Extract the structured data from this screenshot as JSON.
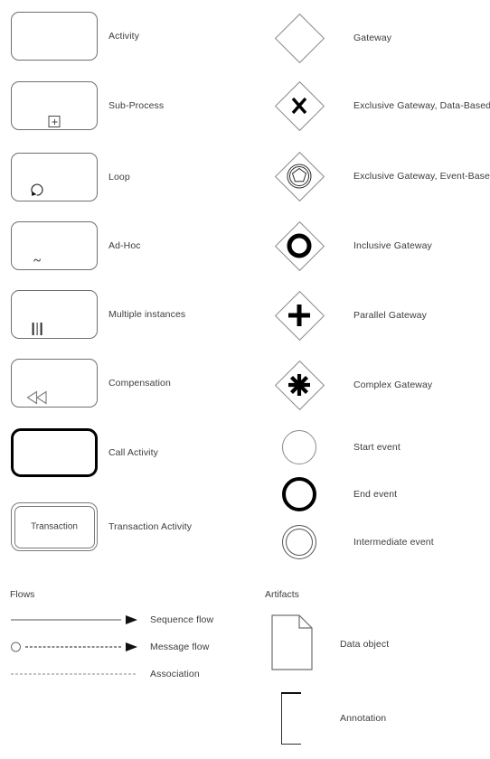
{
  "activities": [
    {
      "label": "Activity",
      "icon": "activity-rounded-rect"
    },
    {
      "label": "Sub-Process",
      "icon": "sub-process-plus-marker-icon"
    },
    {
      "label": "Loop",
      "icon": "loop-marker-icon"
    },
    {
      "label": "Ad-Hoc",
      "icon": "adhoc-tilde-marker-icon"
    },
    {
      "label": "Multiple instances",
      "icon": "multiple-instances-marker-icon"
    },
    {
      "label": "Compensation",
      "icon": "compensation-rewind-marker-icon"
    },
    {
      "label": "Call Activity",
      "icon": "call-activity-thick-rect-icon"
    },
    {
      "label": "Transaction Activity",
      "icon": "transaction-double-rect-icon",
      "inner_text": "Transaction"
    }
  ],
  "gateways": [
    {
      "label": "Gateway",
      "icon": "gateway-diamond-icon"
    },
    {
      "label": "Exclusive Gateway, Data-Based",
      "icon": "exclusive-gateway-x-icon"
    },
    {
      "label": "Exclusive Gateway, Event-Based",
      "icon": "event-based-gateway-pentagon-icon"
    },
    {
      "label": "Inclusive Gateway",
      "icon": "inclusive-gateway-circle-icon"
    },
    {
      "label": "Parallel Gateway",
      "icon": "parallel-gateway-plus-icon"
    },
    {
      "label": "Complex Gateway",
      "icon": "complex-gateway-asterisk-icon"
    }
  ],
  "events": [
    {
      "label": "Start event",
      "icon": "start-event-thin-circle-icon"
    },
    {
      "label": "End event",
      "icon": "end-event-thick-circle-icon"
    },
    {
      "label": "Intermediate event",
      "icon": "intermediate-event-double-circle-icon"
    }
  ],
  "flows": {
    "section_title": "Flows",
    "items": [
      {
        "label": "Sequence flow",
        "icon": "sequence-flow-solid-arrow-icon"
      },
      {
        "label": "Message flow",
        "icon": "message-flow-dashed-arrow-icon"
      },
      {
        "label": "Association",
        "icon": "association-dotted-line-icon"
      }
    ]
  },
  "artifacts": {
    "section_title": "Artifacts",
    "items": [
      {
        "label": "Data object",
        "icon": "data-object-document-icon"
      },
      {
        "label": "Annotation",
        "icon": "annotation-bracket-icon"
      }
    ]
  },
  "colors": {
    "text": "#3c3c3c",
    "shape_outline": "#6f6f6f",
    "bold_glyph": "#000000",
    "background": "#ffffff"
  }
}
